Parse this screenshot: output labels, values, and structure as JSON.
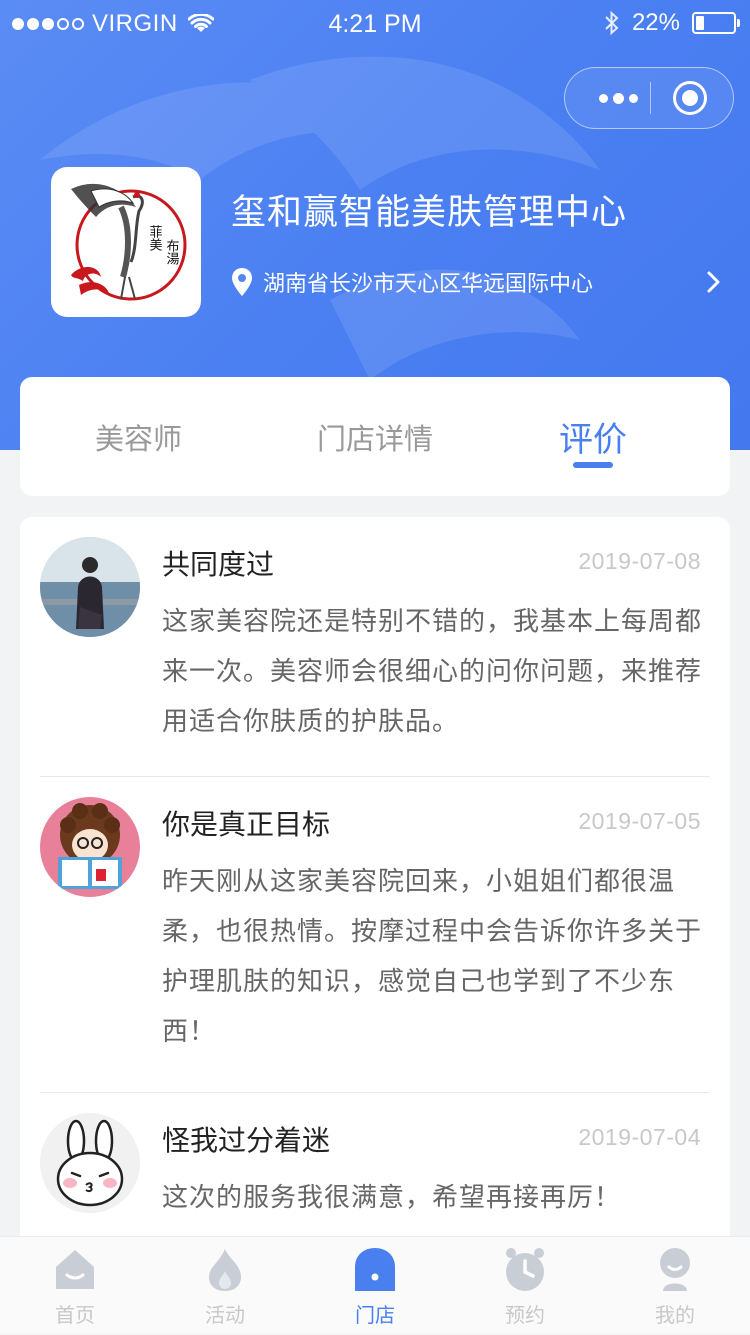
{
  "status_bar": {
    "carrier": "VIRGIN",
    "time": "4:21 PM",
    "battery": "22%",
    "battery_level": 0.22
  },
  "store": {
    "name": "玺和赢智能美肤管理中心",
    "address": "湖南省长沙市天心区华远国际中心",
    "logo_icon": "crane-logo",
    "logo_text": "菲美布湯"
  },
  "tabs": [
    {
      "label": "美容师",
      "active": false
    },
    {
      "label": "门店详情",
      "active": false
    },
    {
      "label": "评价",
      "active": true
    }
  ],
  "reviews": [
    {
      "name": "共同度过",
      "date": "2019-07-08",
      "content": "这家美容院还是特别不错的，我基本上每周都来一次。美容师会很细心的问你问题，来推荐用适合你肤质的护肤品。",
      "avatar": "photo-avatar"
    },
    {
      "name": "你是真正目标",
      "date": "2019-07-05",
      "content": "昨天刚从这家美容院回来，小姐姐们都很温柔，也很热情。按摩过程中会告诉你许多关于护理肌肤的知识，感觉自己也学到了不少东西！",
      "avatar": "reading-girl-avatar"
    },
    {
      "name": "怪我过分着迷",
      "date": "2019-07-04",
      "content": "这次的服务我很满意，希望再接再厉！",
      "avatar": "rabbit-avatar"
    }
  ],
  "nav": [
    {
      "label": "首页",
      "icon": "home-icon",
      "active": false
    },
    {
      "label": "活动",
      "icon": "flame-icon",
      "active": false
    },
    {
      "label": "门店",
      "icon": "store-icon",
      "active": true
    },
    {
      "label": "预约",
      "icon": "clock-icon",
      "active": false
    },
    {
      "label": "我的",
      "icon": "user-icon",
      "active": false
    }
  ],
  "colors": {
    "accent": "#4a7ff0",
    "header_gradient_start": "#5b8cf5",
    "inactive": "#c8c8c8"
  }
}
